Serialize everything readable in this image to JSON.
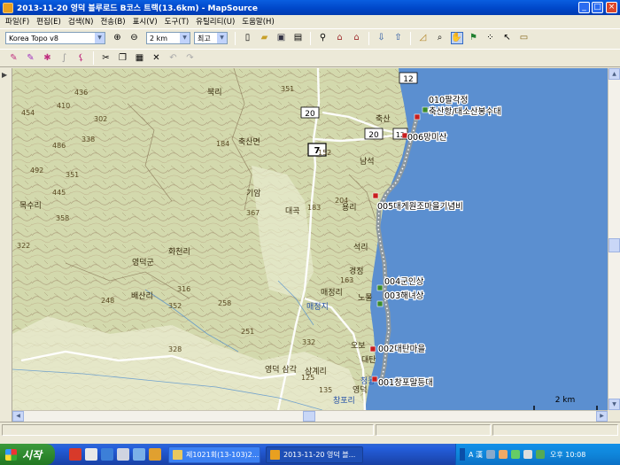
{
  "window": {
    "title": "2013-11-20 영덕 블루로드 B코스 트랙(13.6km) - MapSource",
    "controls": [
      "_",
      "□",
      "×"
    ]
  },
  "menu": [
    "파일(F)",
    "편집(E)",
    "검색(N)",
    "전송(B)",
    "표시(V)",
    "도구(T)",
    "유틸리티(U)",
    "도움말(H)"
  ],
  "toolbar": {
    "map_product": "Korea Topo v8",
    "zoom_scale": "2 km",
    "detail_level": "최고",
    "icons1": [
      "zoom-in-icon",
      "zoom-out-icon",
      "new-icon",
      "open-icon",
      "save-icon",
      "print-icon",
      "find-icon",
      "find-address-icon",
      "find-nearest-icon",
      "receive-icon",
      "send-icon",
      "select-tool-icon",
      "zoom-tool-icon",
      "hand-tool-icon",
      "waypoint-tool-icon",
      "route-tool-icon",
      "pointer-tool-icon",
      "measure-tool-icon"
    ],
    "icons2": [
      "track-edit-icon",
      "route-edit-icon",
      "waypoint-edit-icon",
      "draw-icon",
      "filter-icon",
      "cut-icon",
      "copy-icon",
      "paste-icon",
      "delete-icon",
      "undo-icon",
      "redo-icon"
    ]
  },
  "map": {
    "colors": {
      "land": "#cfd7a8",
      "sea": "#5b8fd0",
      "track": "#b7c2c8",
      "track_dots": "#ffffff",
      "road": "#ffffff",
      "route_marker": "#c81e1e"
    },
    "waypoints": [
      {
        "label": "010팔각정"
      },
      {
        "label": "축산항/대소산봉수대"
      },
      {
        "label": "006망미산"
      },
      {
        "label": "005대게원조마을기념비"
      },
      {
        "label": "004군인상"
      },
      {
        "label": "003해녀상"
      },
      {
        "label": "002대탄마을"
      },
      {
        "label": "001창포말등대"
      }
    ],
    "road_shields": [
      "7",
      "20",
      "20",
      "12",
      "12"
    ],
    "place_names": [
      "축산면",
      "기암",
      "영덕군",
      "화천리",
      "매정리",
      "매정지",
      "노물",
      "오보",
      "대탄",
      "영덕",
      "창포리",
      "청동",
      "삼계리",
      "영덕 삼각",
      "용리",
      "석리",
      "경정",
      "축산",
      "남석",
      "대곡",
      "목수리",
      "배산리",
      "북리"
    ],
    "elevations": [
      "436",
      "410",
      "454",
      "302",
      "338",
      "486",
      "492",
      "351",
      "445",
      "358",
      "322",
      "248",
      "184",
      "352",
      "316",
      "328",
      "251",
      "258",
      "351",
      "367",
      "332",
      "183",
      "152",
      "204",
      "163",
      "125",
      "135"
    ],
    "scale_label": "2 km"
  },
  "statusbar": {},
  "taskbar": {
    "start_label": "시작",
    "tasks": [
      {
        "label": "제1021회(13-103)2..."
      },
      {
        "label": "2013-11-20 영덕 블..."
      }
    ],
    "tray_ime": "A 漢",
    "clock": "오후 10:08"
  }
}
